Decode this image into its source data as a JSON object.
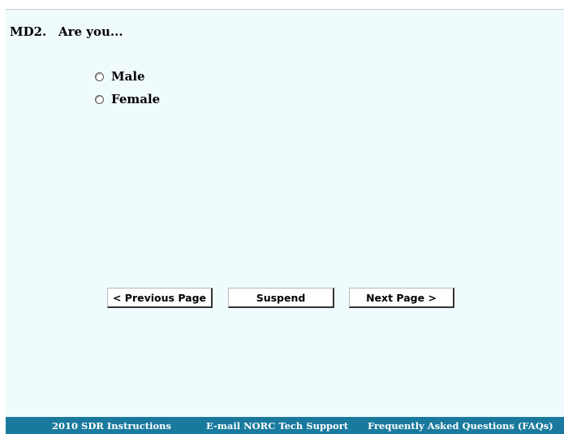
{
  "question": {
    "number": "MD2.",
    "text": "Are you..."
  },
  "options": [
    {
      "label": "Male",
      "selected": false
    },
    {
      "label": "Female",
      "selected": false
    }
  ],
  "navigation": {
    "previous_label": "< Previous Page",
    "suspend_label": "Suspend",
    "next_label": "Next Page >"
  },
  "footer": {
    "links": [
      "2010 SDR Instructions",
      "E-mail NORC Tech Support",
      "Frequently Asked Questions (FAQs)"
    ]
  },
  "colors": {
    "page_background": "#f0fbfd",
    "footer_background": "#1a7a9e",
    "footer_text": "#ffffff"
  }
}
